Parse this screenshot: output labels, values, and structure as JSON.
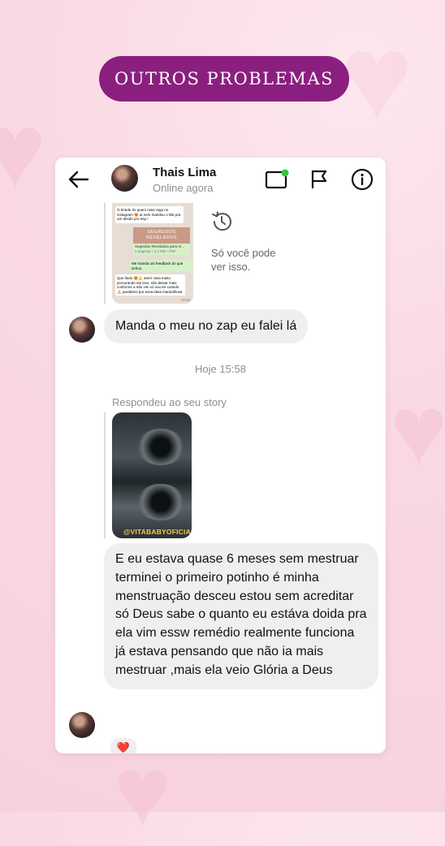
{
  "banner": {
    "title": "OUTROS PROBLEMAS"
  },
  "header": {
    "name": "Thais Lima",
    "status": "Online agora"
  },
  "shared_screenshot": {
    "line1": "O brinde  do quem mais rega no instagram 😍 ai nem mandou o link pra um desde pro esp !",
    "promo_title": "SEGREDOS REVELADOS",
    "link_title": "Segredos Revelados para Vi...",
    "link_meta": "2 páginas • 1,2 MB • PDF",
    "outgoing": "Me manda um feedback do que achou",
    "reply": "Que lindo 😍🙏 amei. tava muito procurando ele isso, não deixar mais conforme a não vim só vou ter comido 🙏 parabéns por essa ideia maravilhosa",
    "time": "21:52"
  },
  "restricted": {
    "text": "Só você pode ver isso."
  },
  "messages": {
    "m1": "Manda o meu no zap eu falei lá",
    "timestamp": "Hoje 15:58",
    "story_reply_label": "Respondeu ao seu story",
    "story_watermark": "@VITABABYOFICIAL",
    "m2": "E eu estava quase 6 meses sem mestruar terminei o primeiro potinho é minha menstruação desceu estou sem acreditar só Deus  sabe o quanto eu estáva doida pra ela  vim essw remédio realmente  funciona  já estava pensando que não ia mais mestruar ,mais ela veio Glória a Deus",
    "reaction": "❤️"
  },
  "colors": {
    "banner": "#8b1f7f",
    "online_dot": "#2dc937",
    "bubble": "#efefef",
    "background": "#f9d9e4"
  },
  "icons": [
    "back-arrow-icon",
    "video-call-icon",
    "flag-icon",
    "info-icon",
    "history-icon",
    "heart-reaction-icon"
  ]
}
